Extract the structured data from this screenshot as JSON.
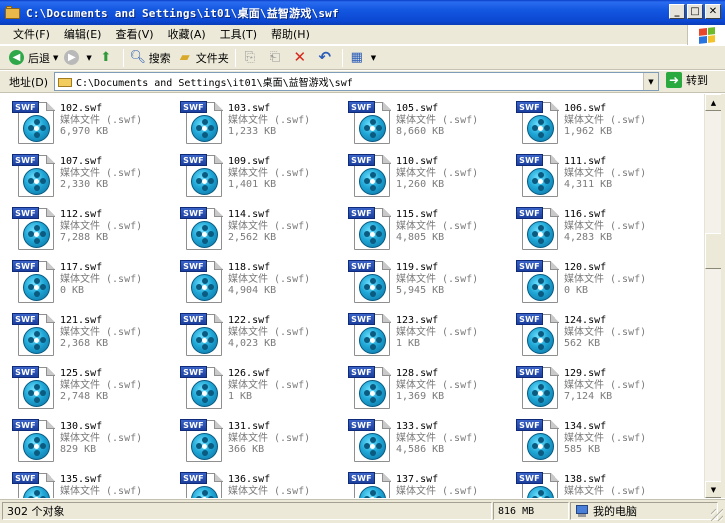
{
  "window": {
    "title": "C:\\Documents and Settings\\it01\\桌面\\益智游戏\\swf",
    "buttons": {
      "minimize": "_",
      "maximize": "□",
      "close": "✕"
    }
  },
  "menu": [
    {
      "label": "文件(F)"
    },
    {
      "label": "编辑(E)"
    },
    {
      "label": "查看(V)"
    },
    {
      "label": "收藏(A)"
    },
    {
      "label": "工具(T)"
    },
    {
      "label": "帮助(H)"
    }
  ],
  "toolbar": {
    "back_label": "后退",
    "search_label": "搜索",
    "folders_label": "文件夹"
  },
  "address": {
    "label": "地址(D)",
    "value": "C:\\Documents and Settings\\it01\\桌面\\益智游戏\\swf",
    "go_label": "转到"
  },
  "files": [
    {
      "name": "102.swf",
      "type": "媒体文件 (.swf)",
      "size": "6,970 KB"
    },
    {
      "name": "103.swf",
      "type": "媒体文件 (.swf)",
      "size": "1,233 KB"
    },
    {
      "name": "105.swf",
      "type": "媒体文件 (.swf)",
      "size": "8,660 KB"
    },
    {
      "name": "106.swf",
      "type": "媒体文件 (.swf)",
      "size": "1,962 KB"
    },
    {
      "name": "107.swf",
      "type": "媒体文件 (.swf)",
      "size": "2,330 KB"
    },
    {
      "name": "109.swf",
      "type": "媒体文件 (.swf)",
      "size": "1,401 KB"
    },
    {
      "name": "110.swf",
      "type": "媒体文件 (.swf)",
      "size": "1,260 KB"
    },
    {
      "name": "111.swf",
      "type": "媒体文件 (.swf)",
      "size": "4,311 KB"
    },
    {
      "name": "112.swf",
      "type": "媒体文件 (.swf)",
      "size": "7,288 KB"
    },
    {
      "name": "114.swf",
      "type": "媒体文件 (.swf)",
      "size": "2,562 KB"
    },
    {
      "name": "115.swf",
      "type": "媒体文件 (.swf)",
      "size": "4,805 KB"
    },
    {
      "name": "116.swf",
      "type": "媒体文件 (.swf)",
      "size": "4,283 KB"
    },
    {
      "name": "117.swf",
      "type": "媒体文件 (.swf)",
      "size": "0 KB"
    },
    {
      "name": "118.swf",
      "type": "媒体文件 (.swf)",
      "size": "4,904 KB"
    },
    {
      "name": "119.swf",
      "type": "媒体文件 (.swf)",
      "size": "5,945 KB"
    },
    {
      "name": "120.swf",
      "type": "媒体文件 (.swf)",
      "size": "0 KB"
    },
    {
      "name": "121.swf",
      "type": "媒体文件 (.swf)",
      "size": "2,368 KB"
    },
    {
      "name": "122.swf",
      "type": "媒体文件 (.swf)",
      "size": "4,023 KB"
    },
    {
      "name": "123.swf",
      "type": "媒体文件 (.swf)",
      "size": "1 KB"
    },
    {
      "name": "124.swf",
      "type": "媒体文件 (.swf)",
      "size": "562 KB"
    },
    {
      "name": "125.swf",
      "type": "媒体文件 (.swf)",
      "size": "2,748 KB"
    },
    {
      "name": "126.swf",
      "type": "媒体文件 (.swf)",
      "size": "1 KB"
    },
    {
      "name": "128.swf",
      "type": "媒体文件 (.swf)",
      "size": "1,369 KB"
    },
    {
      "name": "129.swf",
      "type": "媒体文件 (.swf)",
      "size": "7,124 KB"
    },
    {
      "name": "130.swf",
      "type": "媒体文件 (.swf)",
      "size": "829 KB"
    },
    {
      "name": "131.swf",
      "type": "媒体文件 (.swf)",
      "size": "366 KB"
    },
    {
      "name": "133.swf",
      "type": "媒体文件 (.swf)",
      "size": "4,586 KB"
    },
    {
      "name": "134.swf",
      "type": "媒体文件 (.swf)",
      "size": "585 KB"
    },
    {
      "name": "135.swf",
      "type": "媒体文件 (.swf)",
      "size": ""
    },
    {
      "name": "136.swf",
      "type": "媒体文件 (.swf)",
      "size": ""
    },
    {
      "name": "137.swf",
      "type": "媒体文件 (.swf)",
      "size": ""
    },
    {
      "name": "138.swf",
      "type": "媒体文件 (.swf)",
      "size": ""
    }
  ],
  "file_icon": {
    "tag": "SWF",
    "icon": "swf-media-icon"
  },
  "status": {
    "objects": "302 个对象",
    "size": "816 MB",
    "location": "我的电脑"
  },
  "colors": {
    "titlebar": "#0b47d2",
    "chrome": "#ece9d8",
    "muted_text": "#7a7a7a"
  }
}
